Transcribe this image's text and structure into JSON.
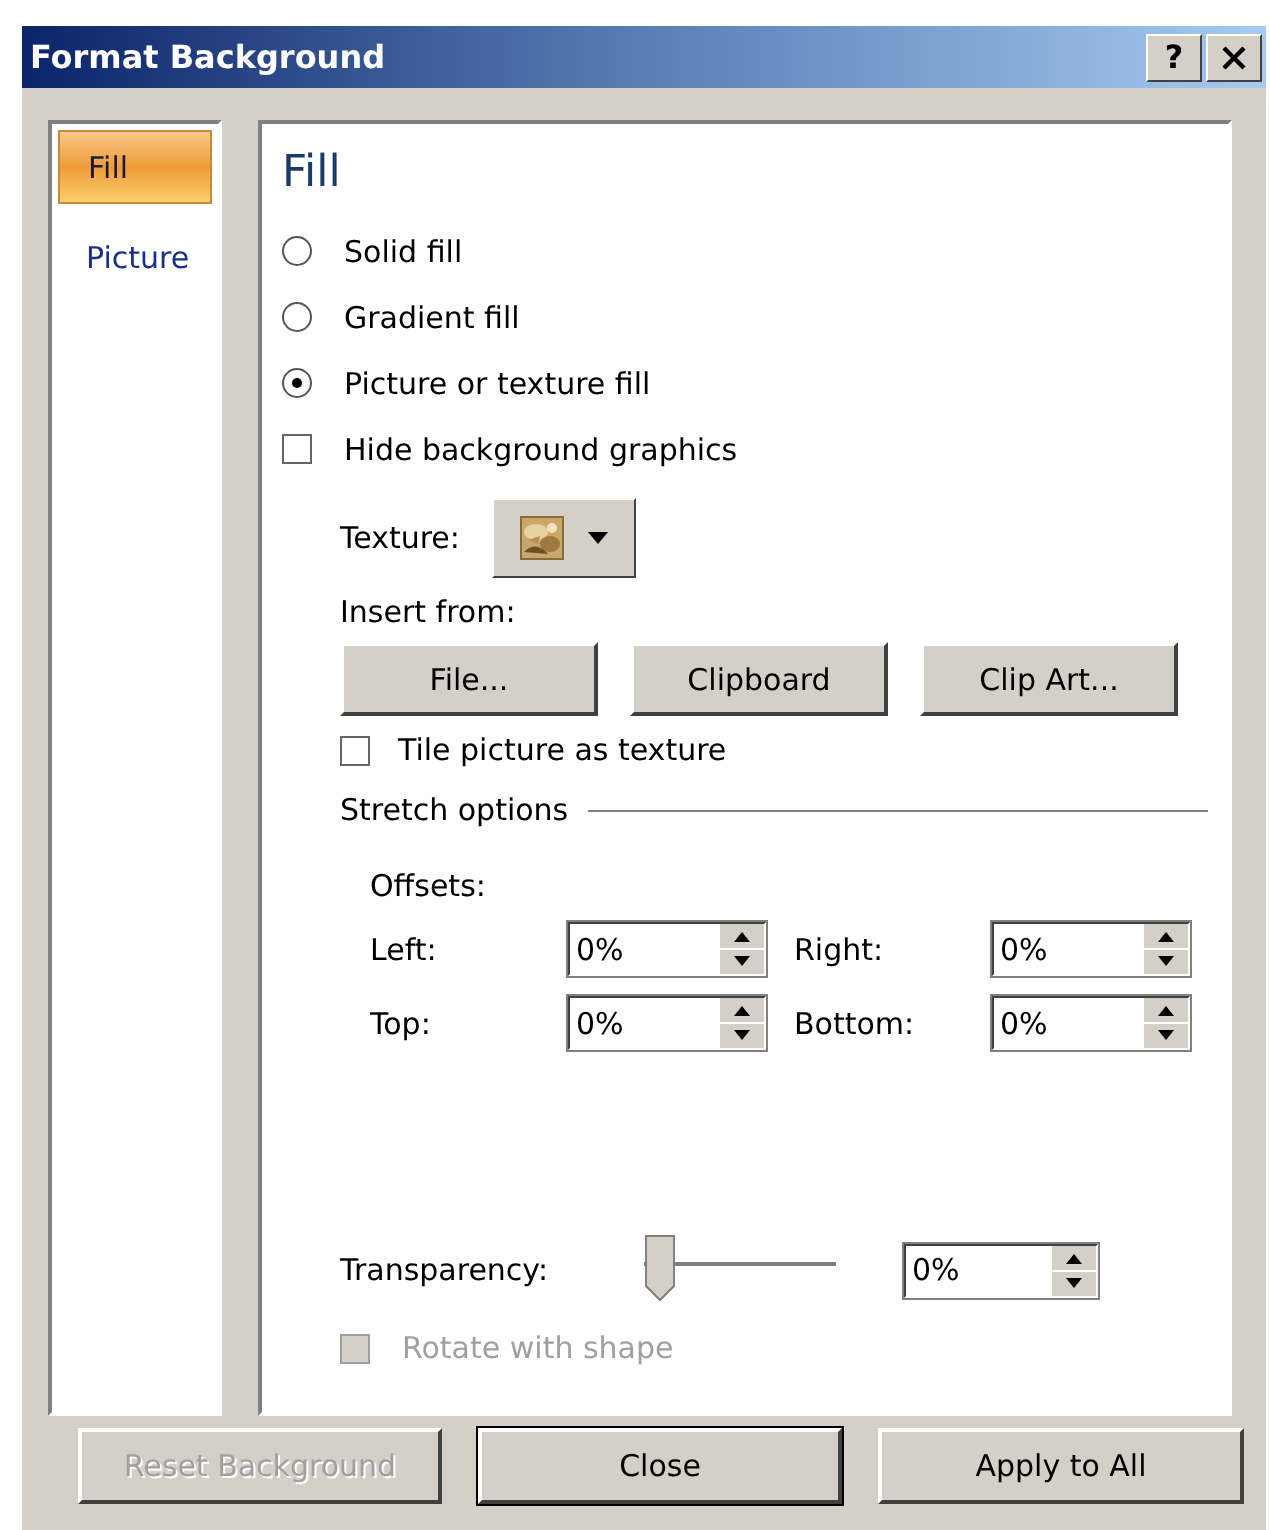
{
  "window": {
    "title": "Format Background",
    "help": "?"
  },
  "sidebar": {
    "items": [
      {
        "label": "Fill",
        "selected": true
      },
      {
        "label": "Picture",
        "selected": false
      }
    ]
  },
  "panel": {
    "heading": "Fill",
    "fill_options": [
      {
        "label": "Solid fill",
        "selected": false
      },
      {
        "label": "Gradient fill",
        "selected": false
      },
      {
        "label": "Picture or texture fill",
        "selected": true
      }
    ],
    "hide_background_graphics": {
      "label": "Hide background graphics",
      "checked": false
    },
    "texture": {
      "label": "Texture:"
    },
    "insert_from": {
      "label": "Insert from:",
      "buttons": [
        "File...",
        "Clipboard",
        "Clip Art..."
      ]
    },
    "tile": {
      "label": "Tile picture as texture",
      "checked": false
    },
    "stretch_options": {
      "label": "Stretch options",
      "offsets_label": "Offsets:",
      "offsets": [
        {
          "label": "Left:",
          "value": "0%"
        },
        {
          "label": "Right:",
          "value": "0%"
        },
        {
          "label": "Top:",
          "value": "0%"
        },
        {
          "label": "Bottom:",
          "value": "0%"
        }
      ]
    },
    "transparency": {
      "label": "Transparency:",
      "level": 0,
      "value": "0%"
    },
    "rotate_with_shape": {
      "label": "Rotate with shape",
      "checked": false,
      "disabled": true
    }
  },
  "buttons": [
    {
      "label": "Reset Background",
      "disabled": true,
      "default": false
    },
    {
      "label": "Close",
      "disabled": false,
      "default": true
    },
    {
      "label": "Apply to All",
      "disabled": false,
      "default": false
    }
  ]
}
